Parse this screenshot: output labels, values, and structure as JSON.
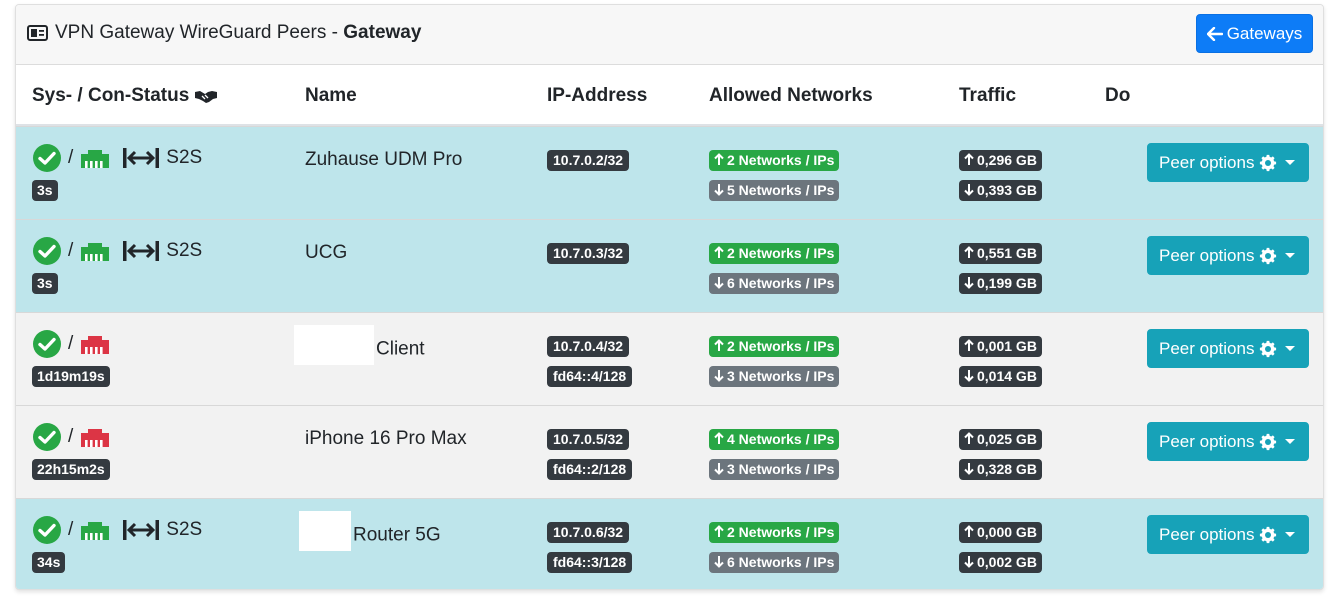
{
  "header": {
    "title_prefix": "VPN Gateway WireGuard Peers - ",
    "title_bold": "Gateway",
    "gateways_button": "Gateways"
  },
  "columns": {
    "status": "Sys- / Con-Status",
    "name": "Name",
    "ip": "IP-Address",
    "networks": "Allowed Networks",
    "traffic": "Traffic",
    "do": "Do"
  },
  "colors": {
    "accent_blue": "#0d7cf7",
    "info": "#17a2b8",
    "success": "#28a745",
    "danger": "#dc3545",
    "secondary": "#6c757d",
    "dark": "#343a40",
    "row_connected": "#bee5eb",
    "row_disconnected": "#f2f2f2"
  },
  "peers": [
    {
      "name": "Zuhause UDM Pro",
      "connected": true,
      "type": "S2S",
      "last_handshake": "3s",
      "ip": [
        "10.7.0.2/32"
      ],
      "networks_up": "2 Networks / IPs",
      "networks_down": "5 Networks / IPs",
      "traffic_up": "0,296 GB",
      "traffic_down": "0,393 GB",
      "options_label": "Peer options"
    },
    {
      "name": "UCG",
      "connected": true,
      "type": "S2S",
      "last_handshake": "3s",
      "ip": [
        "10.7.0.3/32"
      ],
      "networks_up": "2 Networks / IPs",
      "networks_down": "6 Networks / IPs",
      "traffic_up": "0,551 GB",
      "traffic_down": "0,199 GB",
      "options_label": "Peer options"
    },
    {
      "name": "Client",
      "connected": false,
      "type": "",
      "last_handshake": "1d19m19s",
      "ip": [
        "10.7.0.4/32",
        "fd64::4/128"
      ],
      "networks_up": "2 Networks / IPs",
      "networks_down": "3 Networks / IPs",
      "traffic_up": "0,001 GB",
      "traffic_down": "0,014 GB",
      "options_label": "Peer options"
    },
    {
      "name": "iPhone 16 Pro Max",
      "connected": false,
      "type": "",
      "last_handshake": "22h15m2s",
      "ip": [
        "10.7.0.5/32",
        "fd64::2/128"
      ],
      "networks_up": "4 Networks / IPs",
      "networks_down": "3 Networks / IPs",
      "traffic_up": "0,025 GB",
      "traffic_down": "0,328 GB",
      "options_label": "Peer options"
    },
    {
      "name": "Router 5G",
      "connected": true,
      "type": "S2S",
      "last_handshake": "34s",
      "ip": [
        "10.7.0.6/32",
        "fd64::3/128"
      ],
      "networks_up": "2 Networks / IPs",
      "networks_down": "6 Networks / IPs",
      "traffic_up": "0,000 GB",
      "traffic_down": "0,002 GB",
      "options_label": "Peer options"
    }
  ]
}
